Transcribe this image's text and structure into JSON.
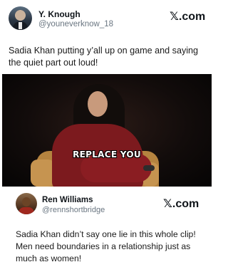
{
  "post1": {
    "author_name": "Y. Knough",
    "author_handle": "@youneverknow_18",
    "brand": {
      "icon": "x-logo",
      "label": "com"
    },
    "text": "Sadia Khan putting y’all up on game and saying the quiet part out loud!",
    "media": {
      "caption": "REPLACE YOU"
    }
  },
  "post2": {
    "author_name": "Ren Williams",
    "author_handle": "@rennshortbridge",
    "brand": {
      "icon": "x-logo",
      "label": "com"
    },
    "text": "Sadia Khan didn’t say one lie in this whole clip! Men need boundaries in a relationship just as much as women!"
  }
}
